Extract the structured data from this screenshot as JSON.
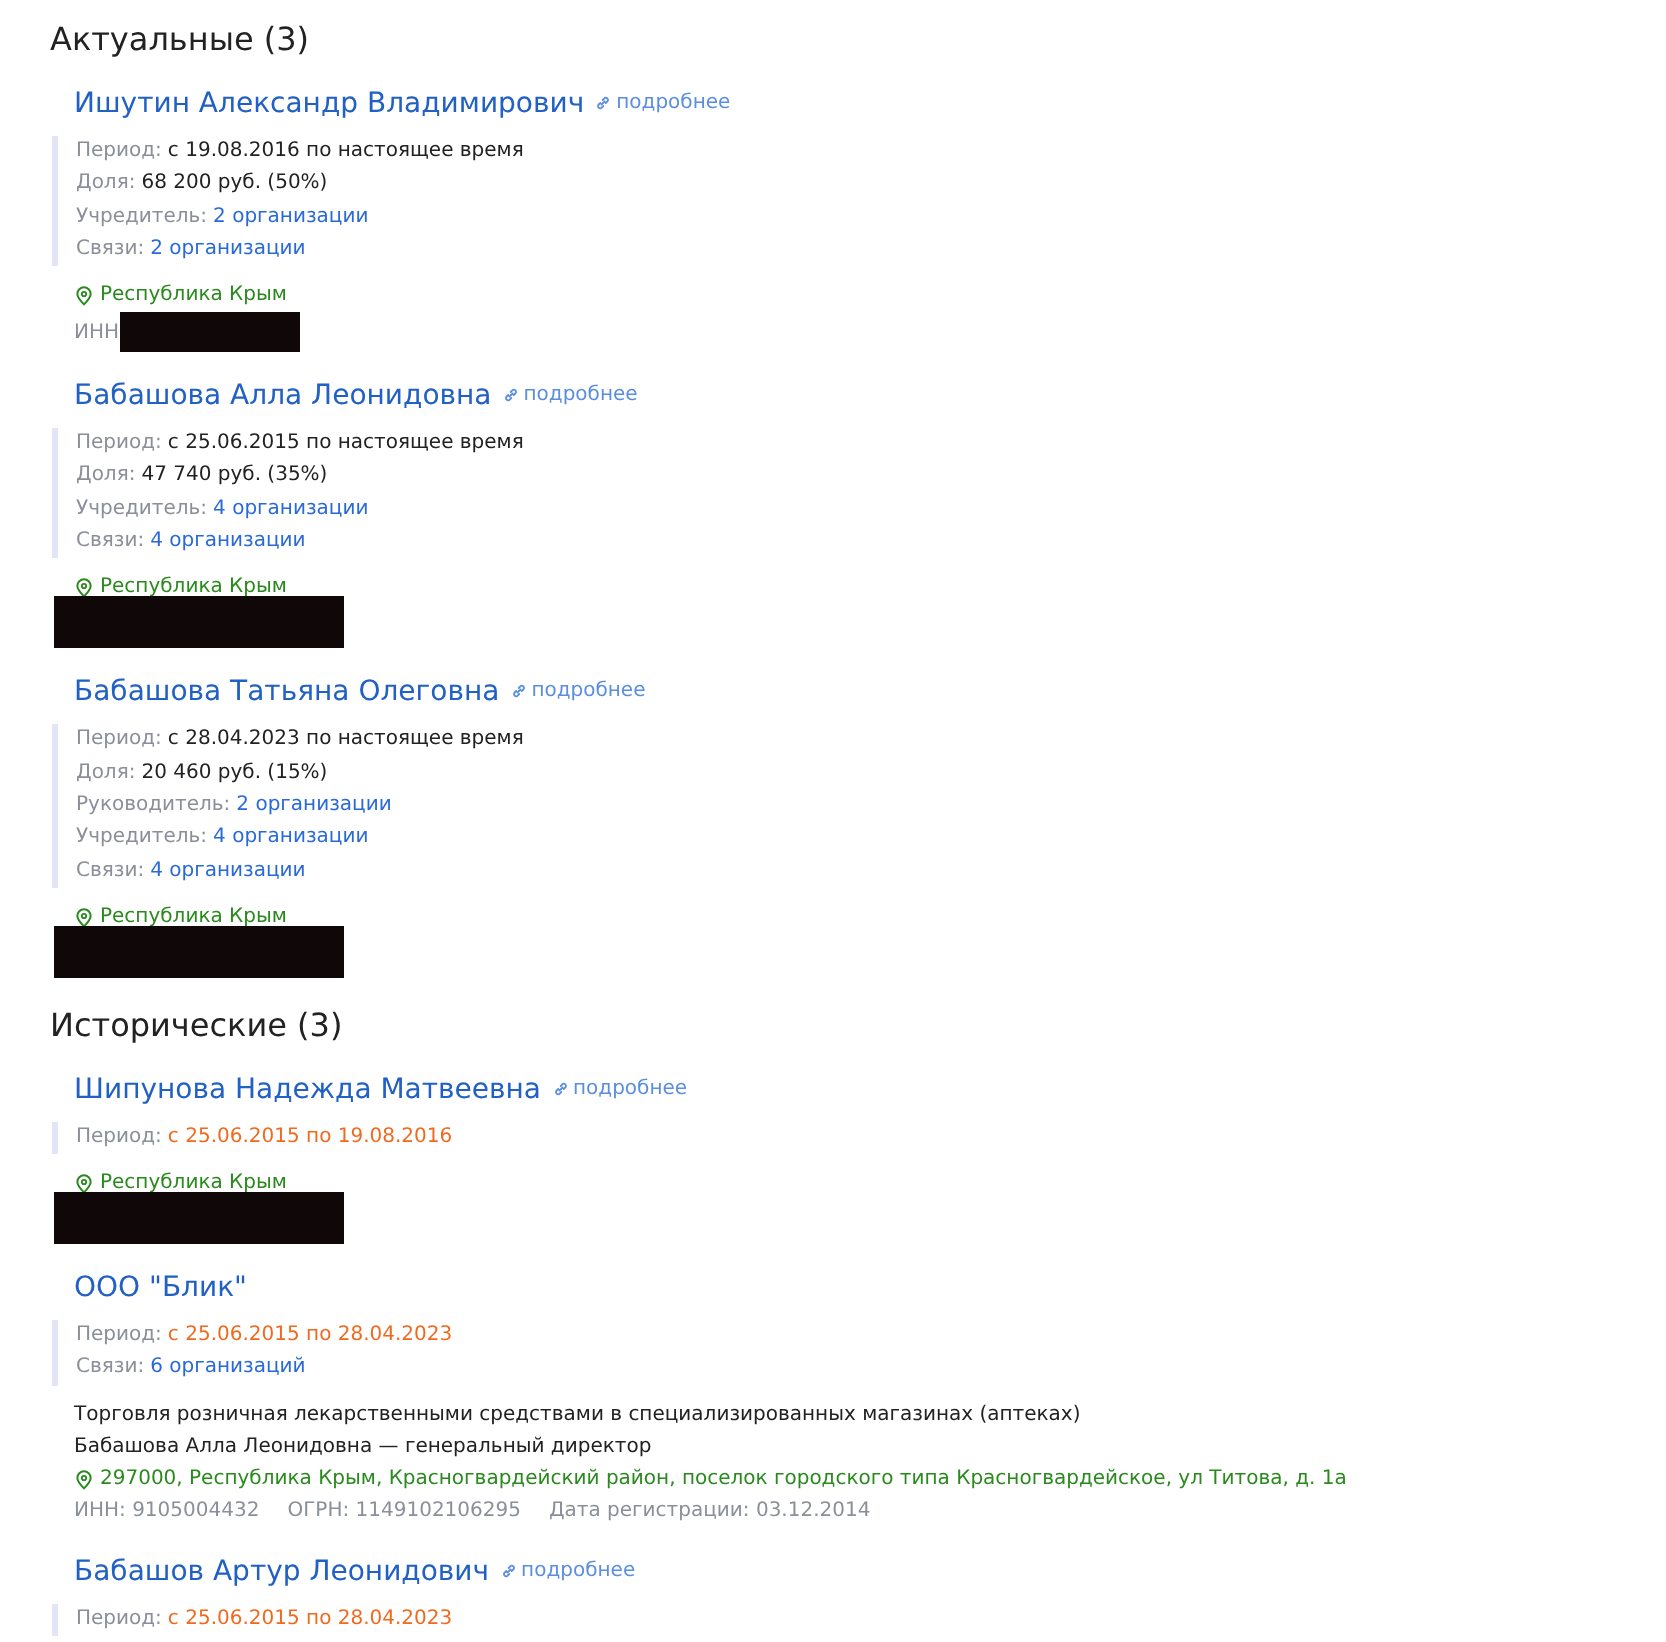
{
  "sections": [
    {
      "title": "Актуальные (3)",
      "entries": [
        {
          "name": "Ишутин Александр Владимирович",
          "more_link": "подробнее",
          "details": [
            {
              "label": "Период:",
              "value": "с 19.08.2016 по настоящее время",
              "kind": "plain"
            },
            {
              "label": "Доля:",
              "value": "68 200 руб. (50%)",
              "kind": "plain"
            },
            {
              "label": "Учредитель:",
              "value": "2 организации",
              "kind": "link"
            },
            {
              "label": "Связи:",
              "value": "2 организации",
              "kind": "link"
            }
          ],
          "location": "Республика Крым",
          "inn_label": "ИНН",
          "redacted": true
        },
        {
          "name": "Бабашова Алла Леонидовна",
          "more_link": "подробнее",
          "details": [
            {
              "label": "Период:",
              "value": "с 25.06.2015 по настоящее время",
              "kind": "plain"
            },
            {
              "label": "Доля:",
              "value": "47 740 руб. (35%)",
              "kind": "plain"
            },
            {
              "label": "Учредитель:",
              "value": "4 организации",
              "kind": "link"
            },
            {
              "label": "Связи:",
              "value": "4 организации",
              "kind": "link"
            }
          ],
          "location": "Республика Крым",
          "redacted": true
        },
        {
          "name": "Бабашова Татьяна Олеговна",
          "more_link": "подробнее",
          "details": [
            {
              "label": "Период:",
              "value": "с 28.04.2023 по настоящее время",
              "kind": "plain"
            },
            {
              "label": "Доля:",
              "value": "20 460 руб. (15%)",
              "kind": "plain"
            },
            {
              "label": "Руководитель:",
              "value": "2 организации",
              "kind": "link"
            },
            {
              "label": "Учредитель:",
              "value": "4 организации",
              "kind": "link"
            },
            {
              "label": "Связи:",
              "value": "4 организации",
              "kind": "link"
            }
          ],
          "location": "Республика Крым",
          "redacted": true
        }
      ]
    },
    {
      "title": "Исторические (3)",
      "entries": [
        {
          "name": "Шипунова Надежда Матвеевна",
          "more_link": "подробнее",
          "details": [
            {
              "label": "Период:",
              "value": "с 25.06.2015 по 19.08.2016",
              "kind": "historic"
            }
          ],
          "location": "Республика Крым",
          "redacted": true
        },
        {
          "name": "ООО \"Блик\"",
          "details": [
            {
              "label": "Период:",
              "value": "с 25.06.2015 по 28.04.2023",
              "kind": "historic"
            },
            {
              "label": "Связи:",
              "value": "6 организаций",
              "kind": "link"
            }
          ],
          "activity": "Торговля розничная лекарственными средствами в специализированных магазинах (аптеках)",
          "director": "Бабашова Алла Леонидовна — генеральный директор",
          "location": "297000, Республика Крым, Красногвардейский район, поселок городского типа Красногвардейское, ул Титова, д. 1а",
          "ids": [
            "ИНН: 9105004432",
            "ОГРН: 1149102106295",
            "Дата регистрации: 03.12.2014"
          ],
          "redacted": false
        },
        {
          "name": "Бабашов Артур Леонидович",
          "more_link": "подробнее",
          "details": [
            {
              "label": "Период:",
              "value": "с 25.06.2015 по 28.04.2023",
              "kind": "historic"
            }
          ],
          "redacted": false
        }
      ]
    }
  ]
}
